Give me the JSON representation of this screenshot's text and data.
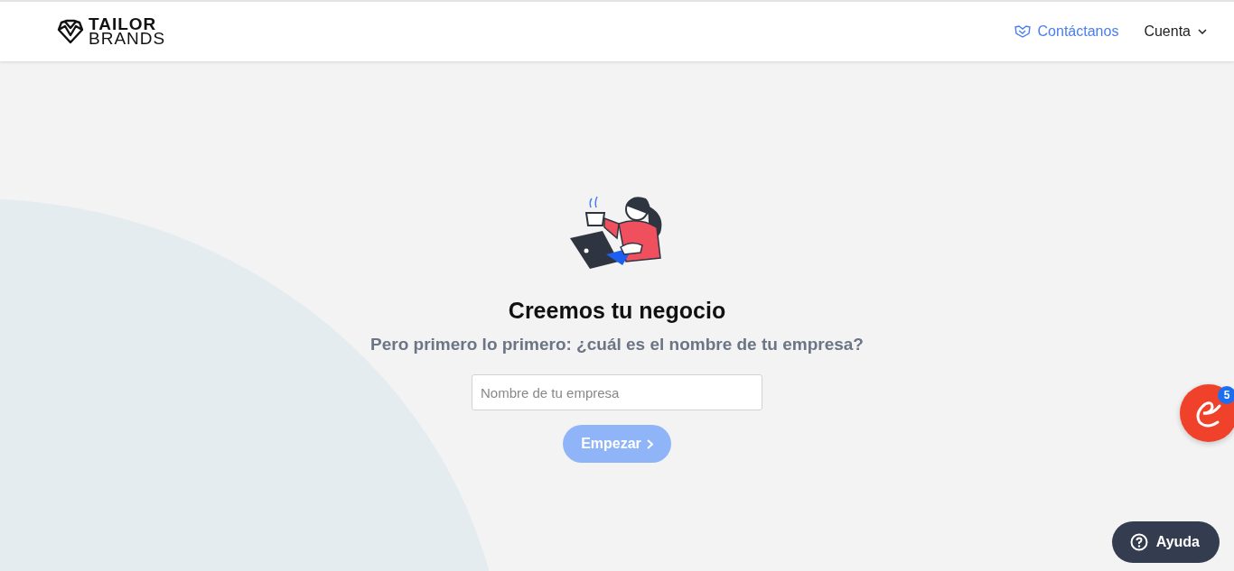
{
  "header": {
    "logo": {
      "line_1": "TAILOR",
      "line_2": "BRANDS"
    },
    "contact_link": "Contáctanos",
    "account_menu": {
      "label": "Cuenta",
      "expanded": false
    }
  },
  "main": {
    "title": "Creemos tu negocio",
    "subtitle": "Pero primero lo primero: ¿cuál es el nombre de tu empresa?",
    "company_field": {
      "placeholder": "Nombre de tu empresa"
    },
    "start_button": {
      "label": "Empezar",
      "disabled": true
    }
  },
  "chat_widget": {
    "badge": "5"
  },
  "help_button": {
    "label": "Ayuda"
  }
}
